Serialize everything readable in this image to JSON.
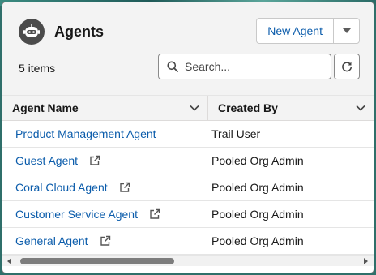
{
  "header": {
    "title": "Agents",
    "item_count": "5 items",
    "new_button": "New Agent"
  },
  "search": {
    "placeholder": "Search..."
  },
  "table": {
    "columns": [
      "Agent Name",
      "Created By"
    ],
    "rows": [
      {
        "name": "Product Management Agent",
        "created_by": "Trail User"
      },
      {
        "name": "Guest Agent",
        "created_by": "Pooled Org Admin"
      },
      {
        "name": "Coral Cloud Agent",
        "created_by": "Pooled Org Admin"
      },
      {
        "name": "Customer Service Agent",
        "created_by": "Pooled Org Admin"
      },
      {
        "name": "General Agent",
        "created_by": "Pooled Org Admin"
      }
    ]
  },
  "scrollbar": {
    "scroll_fraction": 0.42
  },
  "colors": {
    "link": "#0b5cab",
    "header_bg": "#f3f3f3",
    "logo": "#4b4b4b"
  },
  "icons": [
    "agent-robot-icon",
    "chevron-down-icon",
    "search-icon",
    "refresh-icon",
    "external-link-icon"
  ]
}
